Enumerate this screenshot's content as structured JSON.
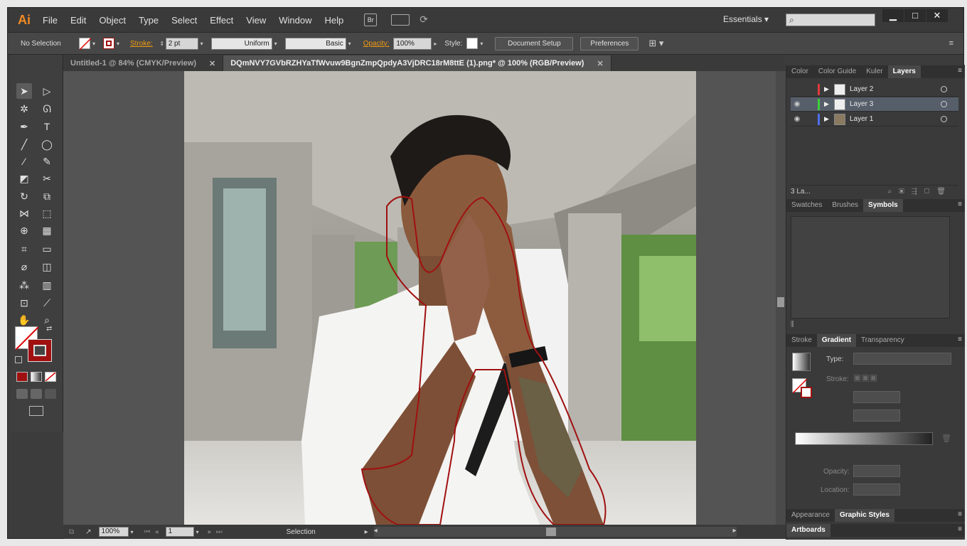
{
  "menubar": {
    "logo": "Ai",
    "items": [
      "File",
      "Edit",
      "Object",
      "Type",
      "Select",
      "Effect",
      "View",
      "Window",
      "Help"
    ],
    "bridge_label": "Br",
    "workspace": "Essentials",
    "window_controls": {
      "minimize": "▁",
      "maximize": "□",
      "close": "✕"
    }
  },
  "controlbar": {
    "selection_state": "No Selection",
    "stroke_label": "Stroke:",
    "stroke_weight": "2 pt",
    "profile": "Uniform",
    "brush": "Basic",
    "opacity_label": "Opacity:",
    "opacity_value": "100%",
    "style_label": "Style:",
    "document_setup": "Document Setup",
    "preferences": "Preferences"
  },
  "doctabs": [
    {
      "label": "Untitled-1 @ 84% (CMYK/Preview)",
      "close": "✕"
    },
    {
      "label": "DQmNVY7GVbRZHYaTfWvuw9BgnZmpQpdyA3VjDRC18rM8ttE (1).png* @ 100% (RGB/Preview)",
      "close": "✕"
    }
  ],
  "status": {
    "zoom": "100%",
    "artboard": "1",
    "tool": "Selection"
  },
  "panels": {
    "color_tabs": [
      "Color",
      "Color Guide",
      "Kuler",
      "Layers"
    ],
    "layers": [
      {
        "name": "Layer 2",
        "color": "#e03a3a",
        "visible": false
      },
      {
        "name": "Layer 3",
        "color": "#3ccf3c",
        "visible": true
      },
      {
        "name": "Layer 1",
        "color": "#4d6ff0",
        "visible": true
      }
    ],
    "layers_count": "3 La...",
    "symbol_tabs": [
      "Swatches",
      "Brushes",
      "Symbols"
    ],
    "gradient_tabs": [
      "Stroke",
      "Gradient",
      "Transparency"
    ],
    "gradient": {
      "type_label": "Type:",
      "stroke_label": "Stroke:",
      "opacity_label": "Opacity:",
      "location_label": "Location:"
    },
    "appearance_tabs": [
      "Appearance",
      "Graphic Styles"
    ],
    "artboards_tab": "Artboards"
  },
  "colors": {
    "accent": "#f08a24",
    "stroke": "#a01010"
  }
}
